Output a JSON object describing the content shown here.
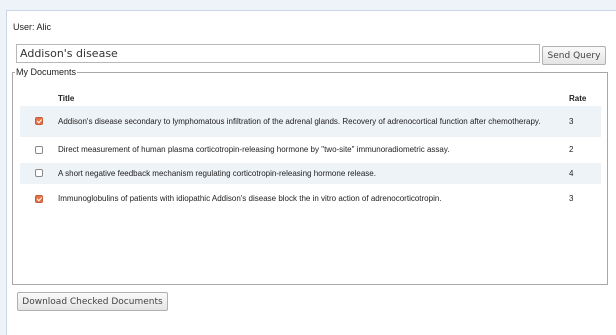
{
  "user": {
    "label": "User: Alic"
  },
  "search": {
    "value": "Addison's disease",
    "button_label": "Send Query"
  },
  "documents": {
    "legend": "My Documents",
    "columns": {
      "title": "Title",
      "rate": "Rate"
    },
    "rows": [
      {
        "checked": true,
        "title": "Addison's disease secondary to lymphomatous infiltration of the adrenal glands. Recovery of adrenocortical function after chemotherapy.",
        "rate": "3"
      },
      {
        "checked": false,
        "title": "Direct measurement of human plasma corticotropin-releasing hormone by \"two-site\" immunoradiometric assay.",
        "rate": "2"
      },
      {
        "checked": false,
        "title": "A short negative feedback mechanism regulating corticotropin-releasing hormone release.",
        "rate": "4"
      },
      {
        "checked": true,
        "title": "Immunoglobulins of patients with idiopathic Addison's disease block the in vitro action of adrenocorticotropin.",
        "rate": "3"
      }
    ]
  },
  "actions": {
    "download_label": "Download Checked Documents"
  }
}
